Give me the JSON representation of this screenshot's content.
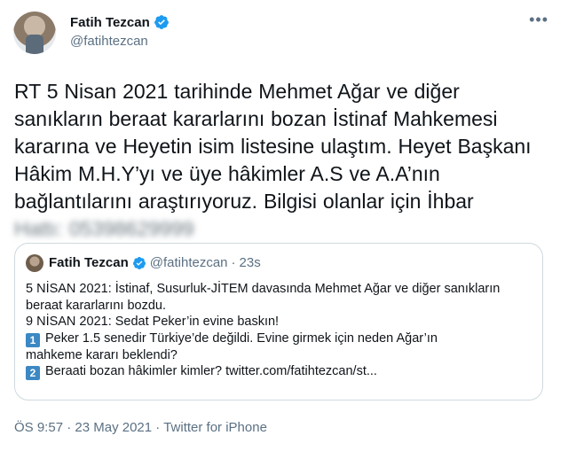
{
  "author": {
    "display_name": "Fatih Tezcan",
    "handle": "@fatihtezcan",
    "more_icon": "more-icon",
    "verified_icon": "verified-badge-icon"
  },
  "tweet": {
    "lines": [
      "RT 5 Nisan 2021 tarihinde Mehmet Ağar ve diğer",
      "sanıkların beraat kararlarını bozan İstinaf Mahkemesi",
      "kararına ve Heyetin isim listesine ulaştım. Heyet Başkanı",
      "Hâkim M.H.Y’yı ve üye hâkimler A.S ve A.A’nın",
      "bağlantılarını araştırıyoruz. Bilgisi olanlar için İhbar",
      "Hattı: 05398629999"
    ]
  },
  "quote": {
    "display_name": "Fatih Tezcan",
    "handle": "@fatihtezcan",
    "separator": "·",
    "time": "23s",
    "lines": [
      "5 NİSAN 2021: İstinaf, Susurluk-JİTEM davasında Mehmet Ağar ve diğer sanıkların",
      "beraat kararlarını bozdu.",
      "9 NİSAN 2021: Sedat Peker’in evine baskın!"
    ],
    "item1_number": "1",
    "item1_line1": "Peker 1.5 senedir Türkiye’de değildi. Evine girmek için neden Ağar’ın",
    "item1_line2": "mahkeme kararı beklendi?",
    "item2_number": "2",
    "item2_text": "Beraati bozan hâkimler kimler? twitter.com/fatihtezcan/st..."
  },
  "meta": {
    "time": "ÖS 9:57",
    "separator1": " · ",
    "date": "23 May 2021",
    "separator2": " · ",
    "source": "Twitter for iPhone"
  },
  "colors": {
    "text": "#0f1419",
    "secondary": "#5b7083",
    "verified": "#1d9bf0",
    "keycap": "#3b88c3"
  }
}
